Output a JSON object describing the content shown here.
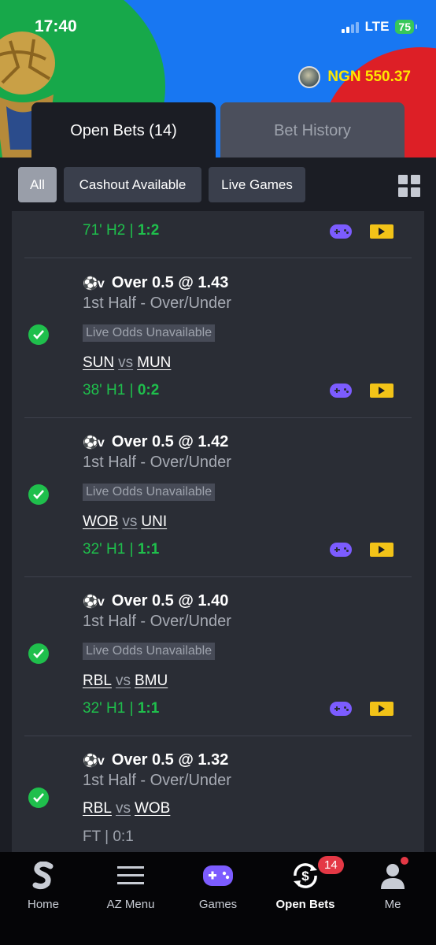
{
  "status_bar": {
    "time": "17:40",
    "network": "LTE",
    "battery": "75"
  },
  "header": {
    "balance": "NGN 550.37"
  },
  "tabs": [
    {
      "label": "Open Bets (14)",
      "active": true
    },
    {
      "label": "Bet History",
      "active": false
    }
  ],
  "filters": [
    {
      "label": "All",
      "selected": true
    },
    {
      "label": "Cashout Available",
      "selected": false
    },
    {
      "label": "Live Games",
      "selected": false
    }
  ],
  "partial_row": {
    "time": "71' H2",
    "sep": " | ",
    "score": "1:2"
  },
  "bets": [
    {
      "icon": "⚽v",
      "title": "Over 0.5 @ 1.43",
      "market": "1st Half  -  Over/Under",
      "odds_status": "Live Odds Unavailable",
      "home": "SUN",
      "vs": "vs",
      "away": "MUN",
      "time": "38' H1",
      "sep": " | ",
      "score": "0:2"
    },
    {
      "icon": "⚽v",
      "title": "Over 0.5 @ 1.42",
      "market": "1st Half  -  Over/Under",
      "odds_status": "Live Odds Unavailable",
      "home": "WOB",
      "vs": "vs",
      "away": "UNI",
      "time": "32' H1",
      "sep": " | ",
      "score": "1:1"
    },
    {
      "icon": "⚽v",
      "title": "Over 0.5 @ 1.40",
      "market": "1st Half  -  Over/Under",
      "odds_status": "Live Odds Unavailable",
      "home": "RBL",
      "vs": "vs",
      "away": "BMU",
      "time": "32' H1",
      "sep": " | ",
      "score": "1:1"
    },
    {
      "icon": "⚽v",
      "title": "Over 0.5 @ 1.32",
      "market": "1st Half  -  Over/Under",
      "home": "RBL",
      "vs": "vs",
      "away": "WOB",
      "result": "FT | 0:1"
    }
  ],
  "bottom_nav": [
    {
      "label": "Home",
      "icon": "sportybet-logo-icon"
    },
    {
      "label": "AZ Menu",
      "icon": "hamburger-menu-icon"
    },
    {
      "label": "Games",
      "icon": "gamepad-icon"
    },
    {
      "label": "Open Bets",
      "icon": "open-bets-icon",
      "active": true
    },
    {
      "label": "Me",
      "icon": "person-icon"
    }
  ],
  "open_bets_badge": "14",
  "colors": {
    "accent_green": "#1fbf4c",
    "balance_yellow": "#ffe600",
    "badge_red": "#e43845",
    "game_purple": "#7c5cff",
    "stream_yellow": "#f2c318"
  }
}
